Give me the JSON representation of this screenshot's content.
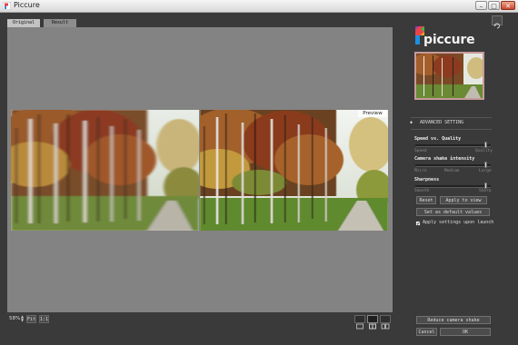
{
  "window": {
    "title": "Piccure",
    "minimize": "–",
    "maximize": "□",
    "close": "✕"
  },
  "tabs": [
    {
      "label": "Original"
    },
    {
      "label": "Result"
    }
  ],
  "viewer": {
    "preview_label": "Preview"
  },
  "bottom_bar": {
    "zoom": "58%",
    "fit_label": "Fit",
    "one_to_one_label": "1:1"
  },
  "panel": {
    "logo_text": "piccure",
    "advanced_title": "ADVANCED SETTING",
    "sliders": [
      {
        "label": "Speed vs. Quality",
        "min_label": "Speed",
        "max_label": "Quality",
        "value": 0.93
      },
      {
        "label": "Camera shake intensity",
        "min_label": "Micro",
        "mid_label": "Medium",
        "max_label": "Large",
        "value": 0.93
      },
      {
        "label": "Sharpness",
        "min_label": "Smooth",
        "max_label": "Sharp",
        "value": 0.93
      }
    ],
    "reset_label": "Reset",
    "apply_label": "Apply to view",
    "default_label": "Set as default values",
    "checkbox_label": "Apply settings upon launch",
    "checkbox_checked": true,
    "reduce_label": "Reduce camera shake",
    "cancel_label": "Cancel",
    "ok_label": "OK"
  }
}
